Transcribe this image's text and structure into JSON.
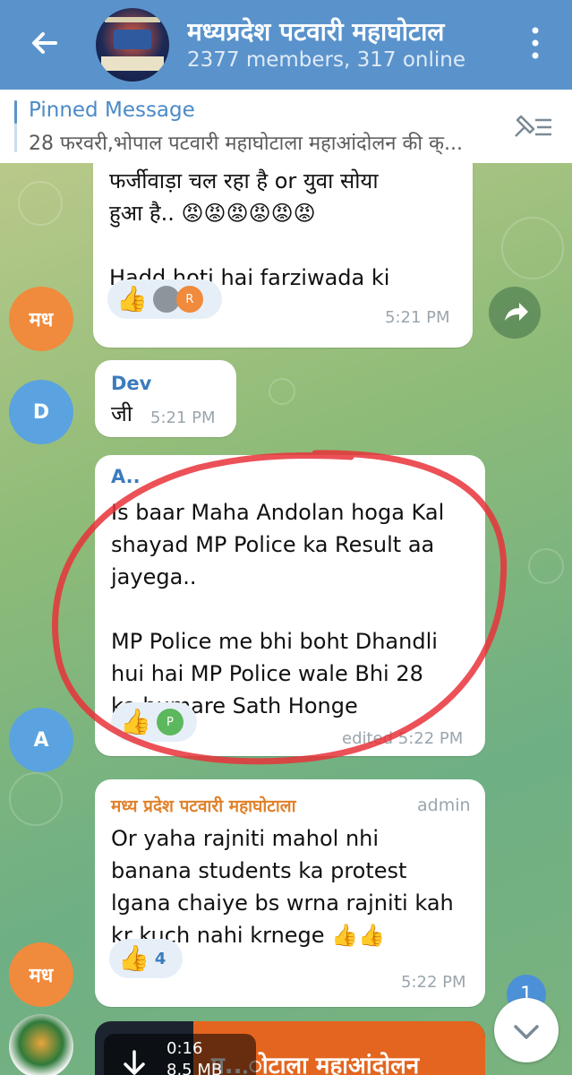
{
  "header": {
    "title": "मध्यप्रदेश पटवारी महाघोटाल",
    "subtitle": "2377 members, 317 online",
    "bg_color": "#5a93cc"
  },
  "pinned": {
    "title": "Pinned Message",
    "text": "28 फरवरी,भोपाल पटवारी महाघोटाला महाआंदोलन की क्..."
  },
  "messages": [
    {
      "avatar": "मध",
      "avatar_color": "#f08a3c",
      "text": "फर्जीवाड़ा चल रहा है or युवा सोया\nहुआ है.. 😡😡😡😡😡😡\n\nHadd hoti hai farziwada ki",
      "reaction": {
        "emoji": "👍",
        "avatars": [
          "",
          "R"
        ]
      },
      "time": "5:21 PM"
    },
    {
      "avatar": "D",
      "avatar_color": "#5aa3e0",
      "sender": "Dev",
      "sender_color": "#3c7bbd",
      "text": "जी",
      "time": "5:21 PM"
    },
    {
      "avatar": "A",
      "avatar_color": "#5aa3e0",
      "sender": "A..",
      "sender_color": "#3c7bbd",
      "text": "Is baar Maha Andolan hoga Kal\nshayad MP Police ka Result aa\njayega..\n\nMP Police me bhi boht Dhandli\nhui hai MP Police wale Bhi  28\nko humare Sath Honge",
      "reaction": {
        "emoji": "👍",
        "avatars": [
          "P"
        ]
      },
      "time": "edited 5:22 PM"
    },
    {
      "avatar": "मध",
      "avatar_color": "#f08a3c",
      "sender": "मध्य प्रदेश पटवारी महाघोटाला",
      "sender_color": "#e0812a",
      "badge": "admin",
      "text": "Or yaha rajniti mahol nhi\nbanana students ka protest\nlgana chaiye bs wrna rajniti kah\nkr kuch nahi krnege 👍👍",
      "reaction": {
        "emoji": "👍",
        "count": "4"
      },
      "time": "5:22 PM"
    }
  ],
  "video": {
    "duration": "0:16",
    "size": "8.5 MB",
    "banner_text": "प...ोटाला महाआंदोलन"
  },
  "unread_count": "1",
  "highlight_color": "#e8323a"
}
